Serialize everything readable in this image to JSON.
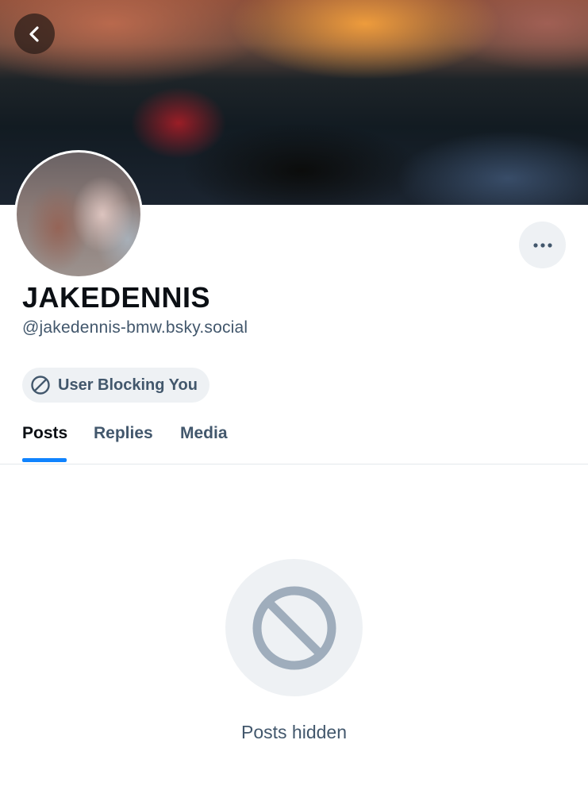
{
  "header": {
    "back_icon": "chevron-left-icon"
  },
  "profile": {
    "display_name": "JAKEDENNIS",
    "handle": "@jakedennis-bmw.bsky.social",
    "more_icon": "ellipsis-icon",
    "badge": {
      "icon": "block-icon",
      "label": "User Blocking You"
    }
  },
  "tabs": [
    {
      "label": "Posts",
      "active": true
    },
    {
      "label": "Replies",
      "active": false
    },
    {
      "label": "Media",
      "active": false
    }
  ],
  "empty_state": {
    "icon": "block-icon",
    "text": "Posts hidden"
  },
  "colors": {
    "accent": "#1083fe",
    "muted_text": "#42576c",
    "badge_bg": "#eef1f4",
    "empty_icon": "#9fadbc"
  }
}
